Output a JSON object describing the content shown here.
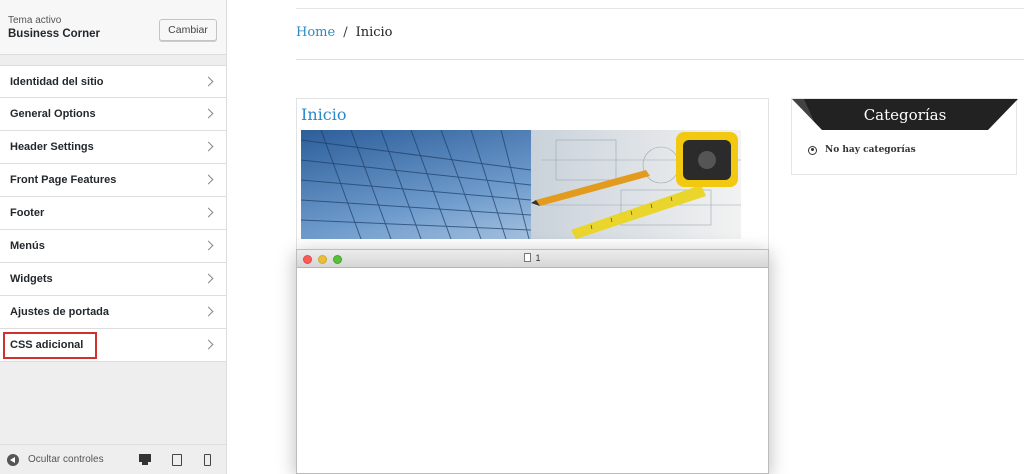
{
  "sidebar": {
    "theme_label": "Tema activo",
    "theme_name": "Business Corner",
    "change_button": "Cambiar",
    "items": [
      {
        "label": "Identidad del sitio"
      },
      {
        "label": "General Options"
      },
      {
        "label": "Header Settings"
      },
      {
        "label": "Front Page Features"
      },
      {
        "label": "Footer"
      },
      {
        "label": "Menús"
      },
      {
        "label": "Widgets"
      },
      {
        "label": "Ajustes de portada"
      },
      {
        "label": "CSS adicional"
      }
    ],
    "highlighted_item": "CSS adicional",
    "collapse_label": "Ocultar controles",
    "device_icons": [
      "desktop-icon",
      "tablet-icon",
      "mobile-icon"
    ]
  },
  "preview": {
    "breadcrumb": {
      "home": "Home",
      "separator": "/",
      "current": "Inicio"
    },
    "post": {
      "title": "Inicio"
    },
    "widget": {
      "title": "Categorías",
      "empty_text": "No hay categorías"
    },
    "window": {
      "title": "1"
    }
  },
  "colors": {
    "link_blue": "#2a8ac8",
    "highlight_red": "#d0312d",
    "widget_header": "#222222"
  }
}
